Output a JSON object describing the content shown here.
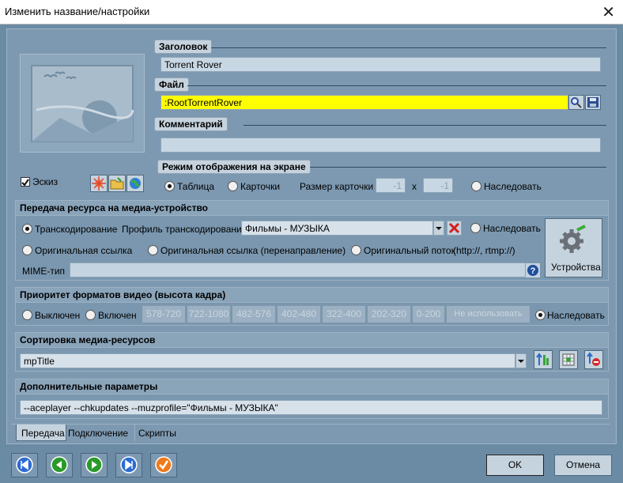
{
  "window": {
    "title": "Изменить название/настройки",
    "close_glyph": "✕"
  },
  "top": {
    "title_label": "Заголовок",
    "title_value": "Torrent Rover",
    "file_label": "Файл",
    "file_value": ":RootTorrentRover",
    "comment_label": "Комментарий",
    "comment_value": "",
    "sketch_label": "Эскиз"
  },
  "display_mode": {
    "label": "Режим отображения на экране",
    "table": "Таблица",
    "cards": "Карточки",
    "card_size_label": "Размер карточки",
    "width": "-1",
    "x": "x",
    "height": "-1",
    "inherit": "Наследовать"
  },
  "transfer": {
    "header": "Передача ресурса на медиа-устройство",
    "transcoding": "Транскодирование",
    "profile_label": "Профиль транскодирования",
    "profile_value": "Фильмы -  МУЗЫКА",
    "inherit": "Наследовать",
    "original_link": "Оригинальная ссылка",
    "original_link_redirect": "Оригинальная ссылка (перенаправление)",
    "original_stream": "Оригинальный поток",
    "stream_hint": "(http://, rtmp://)",
    "mime_label": "MIME-тип",
    "mime_value": "",
    "devices": "Устройства"
  },
  "priority": {
    "header": "Приоритет форматов видео (высота кадра)",
    "off": "Выключен",
    "on": "Включен",
    "segments": [
      "578-720",
      "722-1080",
      "482-576",
      "402-480",
      "322-400",
      "202-320",
      "0-200",
      "Не использовать"
    ],
    "inherit": "Наследовать"
  },
  "sorting": {
    "header": "Сортировка медиа-ресурсов",
    "value": "mpTitle"
  },
  "extra": {
    "header": "Дополнительные параметры",
    "value": "--aceplayer --chkupdates --muzprofile=\"Фильмы -  МУЗЫКА\""
  },
  "tabs": [
    "Передача",
    "Подключение",
    "Скрипты"
  ],
  "footer": {
    "ok": "OK",
    "cancel": "Отмена"
  }
}
